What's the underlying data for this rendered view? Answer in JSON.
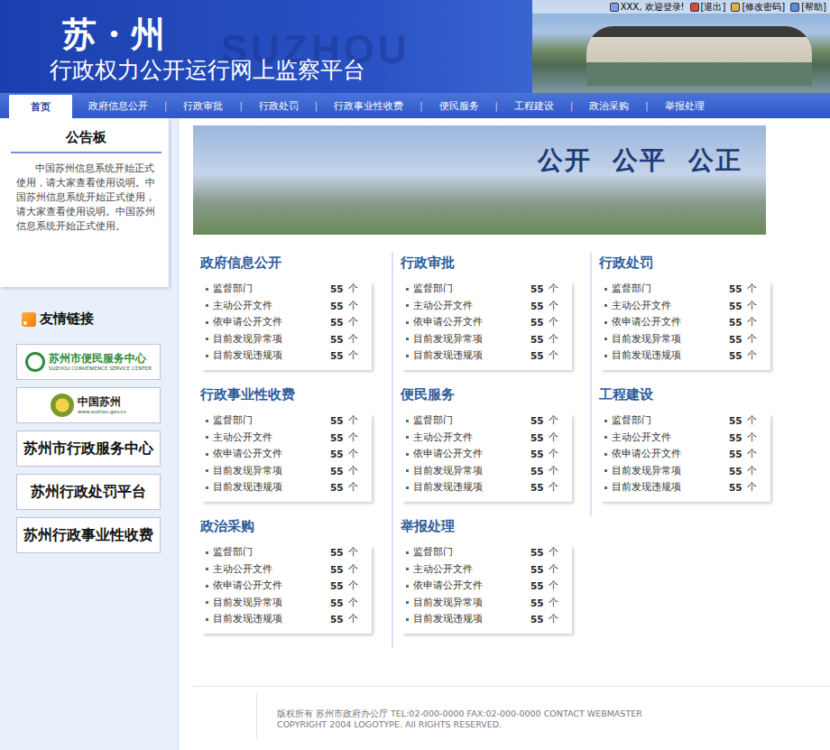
{
  "header": {
    "title": "苏・州",
    "subtitle": "行政权力公开运行网上监察平台",
    "watermark": "SUZHOU",
    "user_links": [
      {
        "label": "XXX, 欢迎登录!",
        "kind": "user"
      },
      {
        "label": "[退出]",
        "kind": "exit"
      },
      {
        "label": "[修改密码]",
        "kind": "password"
      },
      {
        "label": "[帮助]",
        "kind": "help"
      }
    ]
  },
  "nav": [
    {
      "label": "首页",
      "selected": true
    },
    {
      "label": "政府信息公开",
      "selected": false
    },
    {
      "label": "行政审批",
      "selected": false
    },
    {
      "label": "行政处罚",
      "selected": false
    },
    {
      "label": "行政事业性收费",
      "selected": false
    },
    {
      "label": "便民服务",
      "selected": false
    },
    {
      "label": "工程建设",
      "selected": false
    },
    {
      "label": "政治采购",
      "selected": false
    },
    {
      "label": "举报处理",
      "selected": false
    }
  ],
  "notice": {
    "title": "公告板",
    "text": "中国苏州信息系统开始正式使用，请大家查看使用说明。中国苏州信息系统开始正式使用，请大家查看使用说明。中国苏州信息系统开始正式使用。"
  },
  "links": {
    "title": "友情链接",
    "items": [
      {
        "label": "苏州市便民服务中心",
        "sub": "SUZHOU CONVENIENCE SERVICE CENTER",
        "kind": "green"
      },
      {
        "label": "中国苏州",
        "sub": "www.suzhou.gov.cn",
        "kind": "gov"
      },
      {
        "label": "苏州市行政服务中心",
        "sub": "",
        "kind": "text"
      },
      {
        "label": "苏州行政处罚平台",
        "sub": "",
        "kind": "text"
      },
      {
        "label": "苏州行政事业性收费",
        "sub": "",
        "kind": "text"
      }
    ]
  },
  "banner": {
    "slogan": "公开  公平  公正"
  },
  "sections": [
    {
      "title": "政府信息公开",
      "rows": [
        {
          "label": "监督部门",
          "count": "55",
          "unit": "个"
        },
        {
          "label": "主动公开文件",
          "count": "55",
          "unit": "个"
        },
        {
          "label": "依申请公开文件",
          "count": "55",
          "unit": "个"
        },
        {
          "label": "目前发现异常项",
          "count": "55",
          "unit": "个"
        },
        {
          "label": "目前发现违规项",
          "count": "55",
          "unit": "个"
        }
      ]
    },
    {
      "title": "行政审批",
      "rows": [
        {
          "label": "监督部门",
          "count": "55",
          "unit": "个"
        },
        {
          "label": "主动公开文件",
          "count": "55",
          "unit": "个"
        },
        {
          "label": "依申请公开文件",
          "count": "55",
          "unit": "个"
        },
        {
          "label": "目前发现异常项",
          "count": "55",
          "unit": "个"
        },
        {
          "label": "目前发现违规项",
          "count": "55",
          "unit": "个"
        }
      ]
    },
    {
      "title": "行政处罚",
      "rows": [
        {
          "label": "监督部门",
          "count": "55",
          "unit": "个"
        },
        {
          "label": "主动公开文件",
          "count": "55",
          "unit": "个"
        },
        {
          "label": "依申请公开文件",
          "count": "55",
          "unit": "个"
        },
        {
          "label": "目前发现异常项",
          "count": "55",
          "unit": "个"
        },
        {
          "label": "目前发现违规项",
          "count": "55",
          "unit": "个"
        }
      ]
    },
    {
      "title": "行政事业性收费",
      "rows": [
        {
          "label": "监督部门",
          "count": "55",
          "unit": "个"
        },
        {
          "label": "主动公开文件",
          "count": "55",
          "unit": "个"
        },
        {
          "label": "依申请公开文件",
          "count": "55",
          "unit": "个"
        },
        {
          "label": "目前发现异常项",
          "count": "55",
          "unit": "个"
        },
        {
          "label": "目前发现违规项",
          "count": "55",
          "unit": "个"
        }
      ]
    },
    {
      "title": "便民服务",
      "rows": [
        {
          "label": "监督部门",
          "count": "55",
          "unit": "个"
        },
        {
          "label": "主动公开文件",
          "count": "55",
          "unit": "个"
        },
        {
          "label": "依申请公开文件",
          "count": "55",
          "unit": "个"
        },
        {
          "label": "目前发现异常项",
          "count": "55",
          "unit": "个"
        },
        {
          "label": "目前发现违规项",
          "count": "55",
          "unit": "个"
        }
      ]
    },
    {
      "title": "工程建设",
      "rows": [
        {
          "label": "监督部门",
          "count": "55",
          "unit": "个"
        },
        {
          "label": "主动公开文件",
          "count": "55",
          "unit": "个"
        },
        {
          "label": "依申请公开文件",
          "count": "55",
          "unit": "个"
        },
        {
          "label": "目前发现异常项",
          "count": "55",
          "unit": "个"
        },
        {
          "label": "目前发现违规项",
          "count": "55",
          "unit": "个"
        }
      ]
    },
    {
      "title": "政治采购",
      "rows": [
        {
          "label": "监督部门",
          "count": "55",
          "unit": "个"
        },
        {
          "label": "主动公开文件",
          "count": "55",
          "unit": "个"
        },
        {
          "label": "依申请公开文件",
          "count": "55",
          "unit": "个"
        },
        {
          "label": "目前发现异常项",
          "count": "55",
          "unit": "个"
        },
        {
          "label": "目前发现违规项",
          "count": "55",
          "unit": "个"
        }
      ]
    },
    {
      "title": "举报处理",
      "rows": [
        {
          "label": "监督部门",
          "count": "55",
          "unit": "个"
        },
        {
          "label": "主动公开文件",
          "count": "55",
          "unit": "个"
        },
        {
          "label": "依申请公开文件",
          "count": "55",
          "unit": "个"
        },
        {
          "label": "目前发现异常项",
          "count": "55",
          "unit": "个"
        },
        {
          "label": "目前发现违规项",
          "count": "55",
          "unit": "个"
        }
      ]
    }
  ],
  "footer": {
    "lines": [
      "版权所有  苏州市政府办公厅  TEL:02-000-0000 FAX:02-000-0000 CONTACT WEBMASTER",
      "COPYRIGHT 2004 LOGOTYPE. All RIGHTS RESERVED."
    ]
  }
}
